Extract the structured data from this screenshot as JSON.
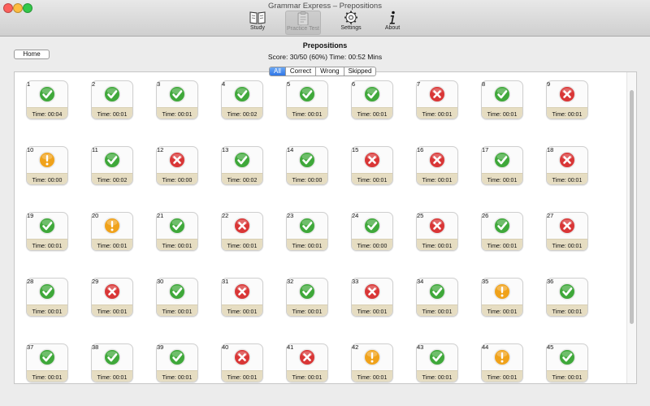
{
  "window": {
    "title": "Grammar Express – Prepositions"
  },
  "toolbar": {
    "study_label": "Study",
    "practice_label": "Practice Test",
    "settings_label": "Settings",
    "about_label": "About"
  },
  "home_label": "Home",
  "quiz": {
    "title": "Prepositions",
    "score": "Score: 30/50 (60%) Time: 00:52 Mins"
  },
  "filters": {
    "all": "All",
    "correct": "Correct",
    "wrong": "Wrong",
    "skipped": "Skipped",
    "selected": "All"
  },
  "status_colors": {
    "correct": "#3fa83a",
    "wrong": "#d93636",
    "skipped": "#f0a21a"
  },
  "questions": [
    {
      "n": "1",
      "status": "correct",
      "time": "Time: 00:04"
    },
    {
      "n": "2",
      "status": "correct",
      "time": "Time: 00:01"
    },
    {
      "n": "3",
      "status": "correct",
      "time": "Time: 00:01"
    },
    {
      "n": "4",
      "status": "correct",
      "time": "Time: 00:02"
    },
    {
      "n": "5",
      "status": "correct",
      "time": "Time: 00:01"
    },
    {
      "n": "6",
      "status": "correct",
      "time": "Time: 00:01"
    },
    {
      "n": "7",
      "status": "wrong",
      "time": "Time: 00:01"
    },
    {
      "n": "8",
      "status": "correct",
      "time": "Time: 00:01"
    },
    {
      "n": "9",
      "status": "wrong",
      "time": "Time: 00:01"
    },
    {
      "n": "10",
      "status": "skipped",
      "time": "Time: 00:00"
    },
    {
      "n": "11",
      "status": "correct",
      "time": "Time: 00:02"
    },
    {
      "n": "12",
      "status": "wrong",
      "time": "Time: 00:00"
    },
    {
      "n": "13",
      "status": "correct",
      "time": "Time: 00:02"
    },
    {
      "n": "14",
      "status": "correct",
      "time": "Time: 00:00"
    },
    {
      "n": "15",
      "status": "wrong",
      "time": "Time: 00:01"
    },
    {
      "n": "16",
      "status": "wrong",
      "time": "Time: 00:01"
    },
    {
      "n": "17",
      "status": "correct",
      "time": "Time: 00:01"
    },
    {
      "n": "18",
      "status": "wrong",
      "time": "Time: 00:01"
    },
    {
      "n": "19",
      "status": "correct",
      "time": "Time: 00:01"
    },
    {
      "n": "20",
      "status": "skipped",
      "time": "Time: 00:01"
    },
    {
      "n": "21",
      "status": "correct",
      "time": "Time: 00:01"
    },
    {
      "n": "22",
      "status": "wrong",
      "time": "Time: 00:01"
    },
    {
      "n": "23",
      "status": "correct",
      "time": "Time: 00:01"
    },
    {
      "n": "24",
      "status": "correct",
      "time": "Time: 00:00"
    },
    {
      "n": "25",
      "status": "wrong",
      "time": "Time: 00:01"
    },
    {
      "n": "26",
      "status": "correct",
      "time": "Time: 00:01"
    },
    {
      "n": "27",
      "status": "wrong",
      "time": "Time: 00:01"
    },
    {
      "n": "28",
      "status": "correct",
      "time": "Time: 00:01"
    },
    {
      "n": "29",
      "status": "wrong",
      "time": "Time: 00:01"
    },
    {
      "n": "30",
      "status": "correct",
      "time": "Time: 00:01"
    },
    {
      "n": "31",
      "status": "wrong",
      "time": "Time: 00:01"
    },
    {
      "n": "32",
      "status": "correct",
      "time": "Time: 00:01"
    },
    {
      "n": "33",
      "status": "wrong",
      "time": "Time: 00:01"
    },
    {
      "n": "34",
      "status": "correct",
      "time": "Time: 00:01"
    },
    {
      "n": "35",
      "status": "skipped",
      "time": "Time: 00:01"
    },
    {
      "n": "36",
      "status": "correct",
      "time": "Time: 00:01"
    },
    {
      "n": "37",
      "status": "correct",
      "time": "Time: 00:01"
    },
    {
      "n": "38",
      "status": "correct",
      "time": "Time: 00:01"
    },
    {
      "n": "39",
      "status": "correct",
      "time": "Time: 00:01"
    },
    {
      "n": "40",
      "status": "wrong",
      "time": "Time: 00:01"
    },
    {
      "n": "41",
      "status": "wrong",
      "time": "Time: 00:01"
    },
    {
      "n": "42",
      "status": "skipped",
      "time": "Time: 00:01"
    },
    {
      "n": "43",
      "status": "correct",
      "time": "Time: 00:01"
    },
    {
      "n": "44",
      "status": "skipped",
      "time": "Time: 00:01"
    },
    {
      "n": "45",
      "status": "correct",
      "time": "Time: 00:01"
    }
  ]
}
